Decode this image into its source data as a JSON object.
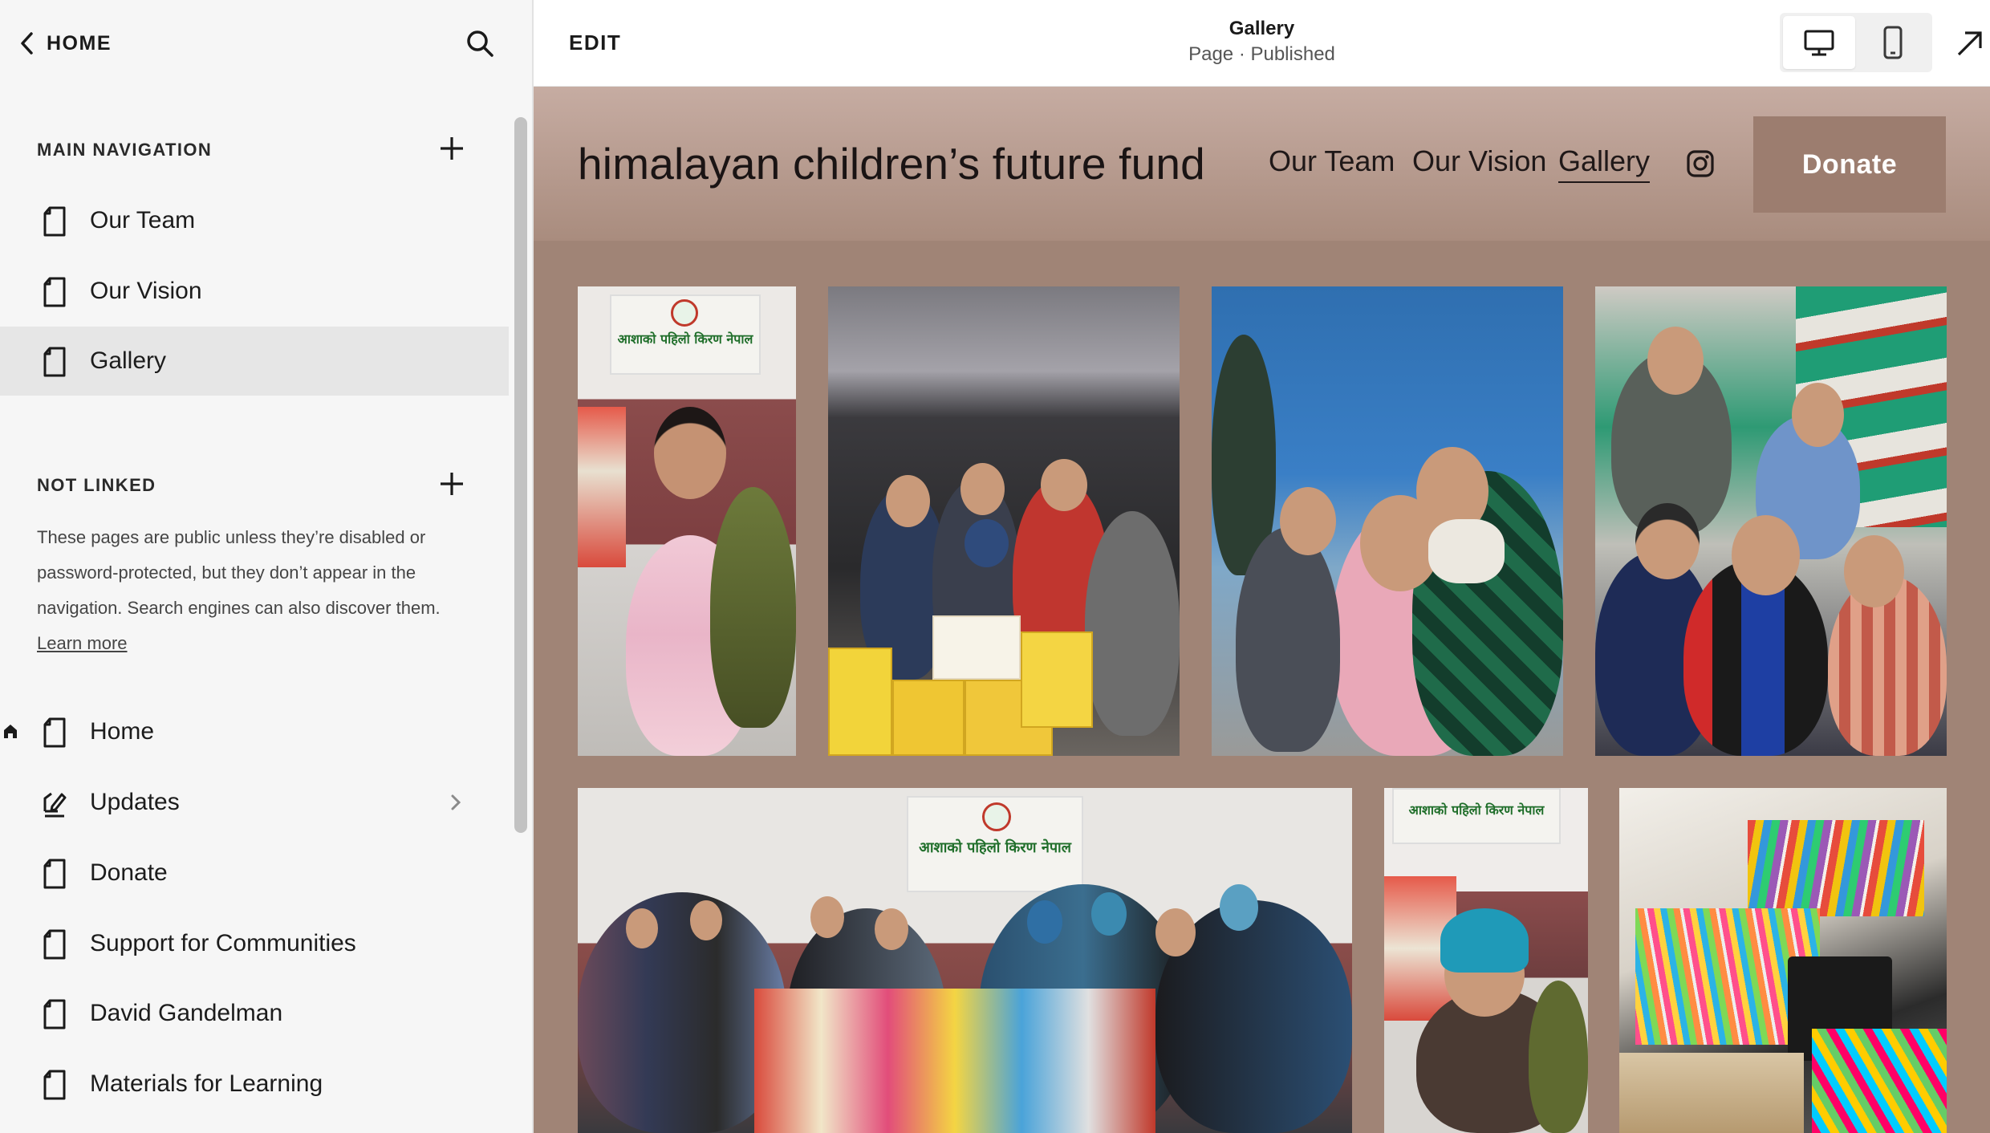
{
  "sidebar": {
    "home_label": "HOME",
    "main_nav_title": "MAIN NAVIGATION",
    "main_nav": [
      "Our Team",
      "Our Vision",
      "Gallery"
    ],
    "not_linked_title": "NOT LINKED",
    "not_linked_desc": "These pages are public unless they’re disabled or password-protected, but they don’t appear in the navigation. Search engines can also discover them.",
    "learn_more": "Learn more",
    "not_linked": [
      "Home",
      "Updates",
      "Donate",
      "Support for Communities",
      "David Gandelman",
      "Materials for Learning"
    ]
  },
  "topbar": {
    "edit_label": "EDIT",
    "page_name": "Gallery",
    "page_status": "Page · Published",
    "device_modes": [
      "desktop-icon",
      "mobile-icon"
    ],
    "active_device": "desktop"
  },
  "site": {
    "title": "himalayan children’s future fund",
    "nav": [
      "Our Team",
      "Our Vision",
      "Gallery"
    ],
    "current_nav": "Gallery",
    "donate_label": "Donate",
    "social_icon": "instagram-icon",
    "header_color": "#b89c90",
    "background_color": "#a08476",
    "sign_text": "आशाको पहिलो किरण नेपाल"
  },
  "gallery": {
    "row1": [
      "photo-girl-pink-jacket",
      "photo-boys-with-boxes",
      "photo-children-blue-wall",
      "photo-boys-with-sacks"
    ],
    "row2": [
      "photo-group-with-donations",
      "photo-boy-blue-hat",
      "photo-art-supplies"
    ]
  },
  "colors": {
    "sidebar_bg": "#f6f6f6",
    "active_item_bg": "#e6e6e6",
    "donate_button": "#9c7d6f"
  }
}
